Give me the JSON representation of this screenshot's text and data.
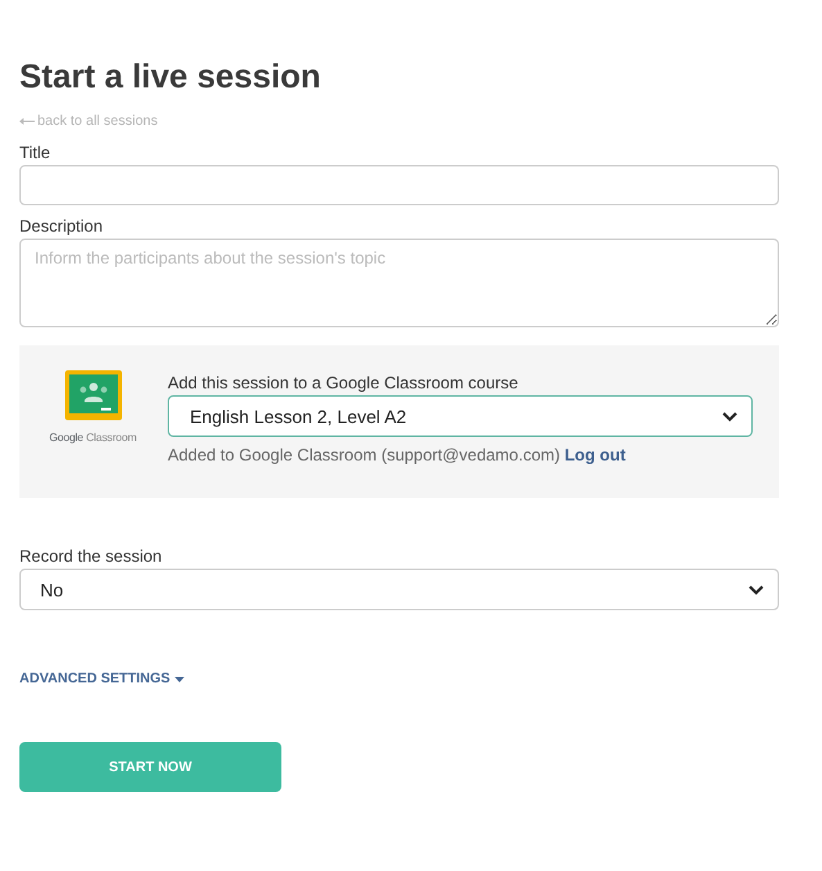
{
  "heading": "Start a live session",
  "back_link": "back to all sessions",
  "fields": [
    {
      "kind": "input",
      "label": "Title"
    },
    {
      "kind": "textarea",
      "label": "Description",
      "placeholder": "Inform the participants about the session's topic"
    }
  ],
  "classroom": {
    "logo_text": [
      "Google",
      "Classroom"
    ],
    "label": "Add this session to a Google Classroom course",
    "course": "English Lesson 2, Level A2",
    "status": "Added to Google Classroom (support@vedamo.com)",
    "logout": "Log out"
  },
  "record": {
    "label": "Record the session",
    "value": "No"
  },
  "advanced": {
    "label": "ADVANCED SETTINGS",
    "expanded": false
  },
  "start_button": "START NOW"
}
